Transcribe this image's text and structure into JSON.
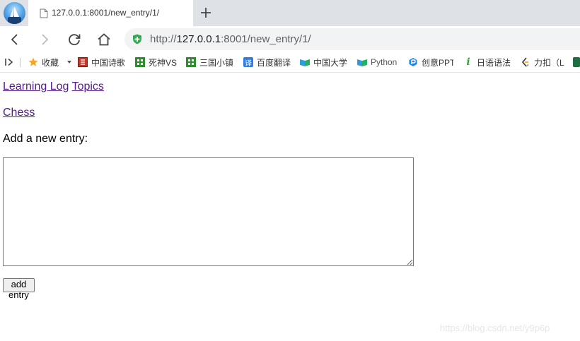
{
  "browser": {
    "tab": {
      "title": "127.0.0.1:8001/new_entry/1/"
    },
    "address": {
      "scheme": "http://",
      "host": "127.0.0.1",
      "rest": ":8001/new_entry/1/"
    },
    "bookmarks": [
      {
        "label": "收藏",
        "icon": "star-icon"
      },
      {
        "label": "中国诗歌",
        "icon": "book-icon"
      },
      {
        "label": "死神VS",
        "icon": "game-icon"
      },
      {
        "label": "三国小镇",
        "icon": "game-icon"
      },
      {
        "label": "百度翻译",
        "icon": "translate-icon"
      },
      {
        "label": "中国大学",
        "icon": "mooc-icon"
      },
      {
        "label": "Python",
        "icon": "mooc-icon"
      },
      {
        "label": "创意PPT",
        "icon": "ppt-icon"
      },
      {
        "label": "日语语法",
        "icon": "info-icon"
      },
      {
        "label": "力扣（L",
        "icon": "leetcode-icon"
      }
    ],
    "colors": {
      "tab_strip": "#dee1e6",
      "omnibox": "#f1f3f4",
      "secure": "#34a853",
      "visited_link": "#551a8b"
    }
  },
  "page": {
    "site_link": "Learning Log",
    "topics_link": "Topics",
    "topic_link": "Chess",
    "form_label": "Add a new entry:",
    "entry_text": "",
    "submit_label": "add entry"
  },
  "watermark": "https://blog.csdn.net/y9p6p"
}
